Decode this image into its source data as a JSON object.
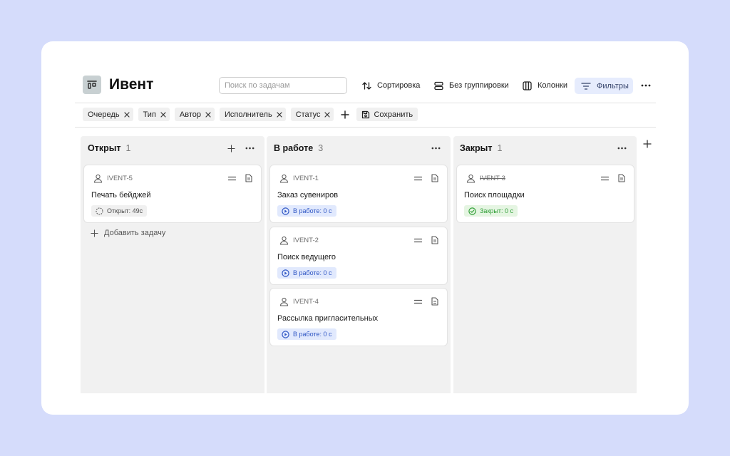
{
  "colors": {
    "page_bg": "#d5dcfb",
    "panel_bg": "#ffffff",
    "board_icon_bg": "#c8d0d2",
    "column_bg": "#f1f1f1",
    "accent_bg": "#e6ecfd",
    "status_open_bg": "#f0f0f0",
    "status_open_text": "#4a4a4a",
    "status_in_progress_bg": "#e1e9fd",
    "status_in_progress_text": "#2f56c4",
    "status_closed_bg": "#e5f5e2",
    "status_closed_text": "#2f9e36"
  },
  "header": {
    "icon": "board-icon",
    "title": "Ивент"
  },
  "search": {
    "placeholder": "Поиск по задачам",
    "value": ""
  },
  "toolbar": {
    "sort": {
      "icon": "sort-icon",
      "label": "Сортировка"
    },
    "grouping": {
      "icon": "grouping-icon",
      "label": "Без группировки"
    },
    "columns": {
      "icon": "columns-icon",
      "label": "Колонки"
    },
    "filters": {
      "icon": "filter-icon",
      "label": "Фильтры",
      "active": true
    },
    "more": {
      "icon": "more-icon"
    }
  },
  "filters": {
    "chips": [
      {
        "label": "Очередь",
        "remove_icon": "close-icon"
      },
      {
        "label": "Тип",
        "remove_icon": "close-icon"
      },
      {
        "label": "Автор",
        "remove_icon": "close-icon"
      },
      {
        "label": "Исполнитель",
        "remove_icon": "close-icon"
      },
      {
        "label": "Статус",
        "remove_icon": "close-icon"
      }
    ],
    "add_icon": "plus-icon",
    "save": {
      "icon": "save-icon",
      "label": "Сохранить"
    }
  },
  "board": {
    "add_column_icon": "plus-icon",
    "columns": [
      {
        "title": "Открыт",
        "count": 1,
        "cards": [
          {
            "key": "IVENT-5",
            "title": "Печать бейджей",
            "status": "Открыт: 49с",
            "status_icon": "dashed-circle-icon",
            "key_strikethrough": false
          }
        ],
        "add_task": {
          "icon": "plus-icon",
          "label": "Добавить задачу"
        }
      },
      {
        "title": "В работе",
        "count": 3,
        "cards": [
          {
            "key": "IVENT-1",
            "title": "Заказ сувениров",
            "status": "В работе: 0 с",
            "status_icon": "play-circle-icon",
            "key_strikethrough": false
          },
          {
            "key": "IVENT-2",
            "title": "Поиск ведущего",
            "status": "В работе: 0 с",
            "status_icon": "play-circle-icon",
            "key_strikethrough": false
          },
          {
            "key": "IVENT-4",
            "title": "Рассылка пригласительных",
            "status": "В работе: 0 с",
            "status_icon": "play-circle-icon",
            "key_strikethrough": false
          }
        ]
      },
      {
        "title": "Закрыт",
        "count": 1,
        "cards": [
          {
            "key": "IVENT-3",
            "title": "Поиск площадки",
            "status": "Закрыт: 0 с",
            "status_icon": "check-circle-icon",
            "key_strikethrough": true
          }
        ]
      }
    ]
  }
}
